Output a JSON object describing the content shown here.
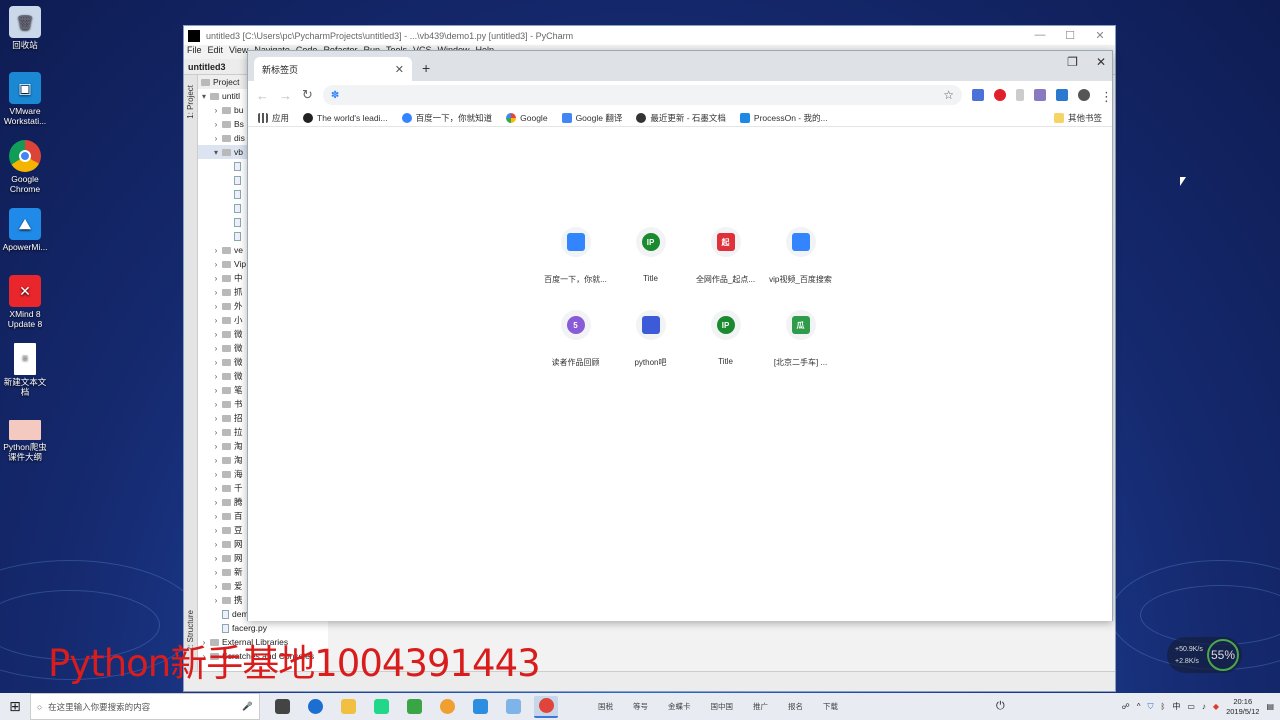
{
  "desktop": {
    "icons": [
      {
        "label": "回收站",
        "icon": "recycle-bin-icon",
        "color": "#b0c4de"
      },
      {
        "label": "VMware Workstati...",
        "icon": "vmware-icon",
        "color": "#1b88d4"
      },
      {
        "label": "Google Chrome",
        "icon": "chrome-icon",
        "color": "#e0443a"
      },
      {
        "label": "ApowerMi...",
        "icon": "apowermirror-icon",
        "color": "#1f8ae8"
      },
      {
        "label": "XMind 8 Update 8",
        "icon": "xmind-icon",
        "color": "#e8262c"
      },
      {
        "label": "新建文本文档",
        "icon": "text-file-icon",
        "color": "#ffffff"
      },
      {
        "label": "Python爬虫课件大纲",
        "icon": "image-file-icon",
        "color": "#f4c9c0"
      }
    ]
  },
  "pycharm": {
    "title": "untitled3 [C:\\Users\\pc\\PycharmProjects\\untitled3] - ...\\vb439\\demo1.py [untitled3] - PyCharm",
    "menu": [
      "File",
      "Edit",
      "View",
      "Navigate",
      "Code",
      "Refactor",
      "Run",
      "Tools",
      "VCS",
      "Window",
      "Help"
    ],
    "project_tab": "untitled3",
    "tool_window": "Project",
    "side_tabs": {
      "project": "1: Project",
      "structure": "2: Structure"
    },
    "tree": [
      {
        "label": "untitl",
        "level": 0,
        "type": "folder",
        "expanded": true
      },
      {
        "label": "bu",
        "level": 1,
        "type": "folder"
      },
      {
        "label": "Bs",
        "level": 1,
        "type": "folder"
      },
      {
        "label": "dis",
        "level": 1,
        "type": "folder"
      },
      {
        "label": "vb",
        "level": 1,
        "type": "folder",
        "expanded": true
      },
      {
        "label": "",
        "level": 2,
        "type": "file"
      },
      {
        "label": "",
        "level": 2,
        "type": "file"
      },
      {
        "label": "",
        "level": 2,
        "type": "file"
      },
      {
        "label": "",
        "level": 2,
        "type": "file"
      },
      {
        "label": "",
        "level": 2,
        "type": "file"
      },
      {
        "label": "",
        "level": 2,
        "type": "file"
      },
      {
        "label": "ve",
        "level": 1,
        "type": "folder"
      },
      {
        "label": "Vip",
        "level": 1,
        "type": "folder"
      },
      {
        "label": "中",
        "level": 1,
        "type": "folder"
      },
      {
        "label": "抓",
        "level": 1,
        "type": "folder"
      },
      {
        "label": "外",
        "level": 1,
        "type": "folder"
      },
      {
        "label": "小",
        "level": 1,
        "type": "folder"
      },
      {
        "label": "微",
        "level": 1,
        "type": "folder"
      },
      {
        "label": "微",
        "level": 1,
        "type": "folder"
      },
      {
        "label": "微",
        "level": 1,
        "type": "folder"
      },
      {
        "label": "微",
        "level": 1,
        "type": "folder"
      },
      {
        "label": "笔",
        "level": 1,
        "type": "folder"
      },
      {
        "label": "书",
        "level": 1,
        "type": "folder"
      },
      {
        "label": "招",
        "level": 1,
        "type": "folder"
      },
      {
        "label": "拉",
        "level": 1,
        "type": "folder"
      },
      {
        "label": "淘",
        "level": 1,
        "type": "folder"
      },
      {
        "label": "淘",
        "level": 1,
        "type": "folder"
      },
      {
        "label": "海",
        "level": 1,
        "type": "folder"
      },
      {
        "label": "千",
        "level": 1,
        "type": "folder"
      },
      {
        "label": "腾",
        "level": 1,
        "type": "folder"
      },
      {
        "label": "百",
        "level": 1,
        "type": "folder"
      },
      {
        "label": "豆",
        "level": 1,
        "type": "folder"
      },
      {
        "label": "网",
        "level": 1,
        "type": "folder"
      },
      {
        "label": "网",
        "level": 1,
        "type": "folder"
      },
      {
        "label": "新",
        "level": 1,
        "type": "folder"
      },
      {
        "label": "爱",
        "level": 1,
        "type": "folder"
      },
      {
        "label": "携",
        "level": 1,
        "type": "folder"
      },
      {
        "label": "demo.spec",
        "level": 1,
        "type": "file"
      },
      {
        "label": "facerg.py",
        "level": 1,
        "type": "file"
      },
      {
        "label": "External Libraries",
        "level": 0,
        "type": "folder"
      },
      {
        "label": "Scratches and Consoles",
        "level": 0,
        "type": "folder"
      }
    ]
  },
  "chrome": {
    "tab_title": "新标签页",
    "omnibox": {
      "value": "",
      "placeholder": ""
    },
    "bookmarks": [
      {
        "label": "应用",
        "icon": "apps-grid-icon",
        "color": "#555555"
      },
      {
        "label": "The world's leadi...",
        "icon": "github-icon",
        "color": "#222222"
      },
      {
        "label": "百度一下，你就知道",
        "icon": "baidu-paw-icon",
        "color": "#3385ff"
      },
      {
        "label": "Google",
        "icon": "google-g-icon",
        "color": "#4285f4"
      },
      {
        "label": "Google 翻译",
        "icon": "google-translate-icon",
        "color": "#4285f4"
      },
      {
        "label": "最近更新 - 石墨文档",
        "icon": "shimo-icon",
        "color": "#333333"
      },
      {
        "label": "ProcessOn - 我的...",
        "icon": "processon-icon",
        "color": "#1e88e5"
      }
    ],
    "other_bookmarks": "其他书签",
    "tiles": [
      {
        "label": "百度一下，你就...",
        "icon": "baidu-paw-icon",
        "color": "#3385ff",
        "glyph": ""
      },
      {
        "label": "Title",
        "icon": "ip-icon",
        "color": "#1a8a2e",
        "glyph": "IP"
      },
      {
        "label": "全网作品_起点...",
        "icon": "qidian-icon",
        "color": "#e0303a",
        "glyph": "起"
      },
      {
        "label": "vip视频_百度搜索",
        "icon": "baidu-paw-icon",
        "color": "#3385ff",
        "glyph": ""
      },
      {
        "label": "读者作品回顾",
        "icon": "five-icon",
        "color": "#8a5bd6",
        "glyph": "5"
      },
      {
        "label": "python吧",
        "icon": "tieba-icon",
        "color": "#3d5ad8",
        "glyph": ""
      },
      {
        "label": "Title",
        "icon": "ip-icon",
        "color": "#1a8a2e",
        "glyph": "IP"
      },
      {
        "label": "[北京二手车] ...",
        "icon": "guazi-icon",
        "color": "#2e9c4a",
        "glyph": "瓜"
      }
    ]
  },
  "watermark": "Python新手基地1004391443",
  "net_meter": {
    "up": "+50.9K/s",
    "down": "+2.8K/s",
    "percent": "55%"
  },
  "taskbar": {
    "search_placeholder": "在这里输入你要搜索的内容",
    "apps": [
      {
        "icon": "task-view-icon",
        "color": "#444444"
      },
      {
        "icon": "edge-icon",
        "color": "#1c6fd1"
      },
      {
        "icon": "file-explorer-icon",
        "color": "#f2c040"
      },
      {
        "icon": "pycharm-icon",
        "color": "#21d789"
      },
      {
        "icon": "notepad-icon",
        "color": "#3aa545"
      },
      {
        "icon": "app-orange-icon",
        "color": "#f0a030"
      },
      {
        "icon": "app-blue-icon",
        "color": "#2d8de0"
      },
      {
        "icon": "app-paper-icon",
        "color": "#7fb4e8"
      },
      {
        "icon": "chrome-icon",
        "color": "#e0443a"
      }
    ],
    "labels": [
      "国税",
      "等号",
      "金蝶卡",
      "国中国",
      "推广",
      "报名",
      "下载"
    ],
    "tray_lang": "中",
    "time": "20:16",
    "date": "2019/5/12"
  },
  "colors": {
    "desktop_bg": "#1d3f95",
    "watermark": "#d91c1c",
    "chrome_tab_strip": "#dee1e6"
  }
}
